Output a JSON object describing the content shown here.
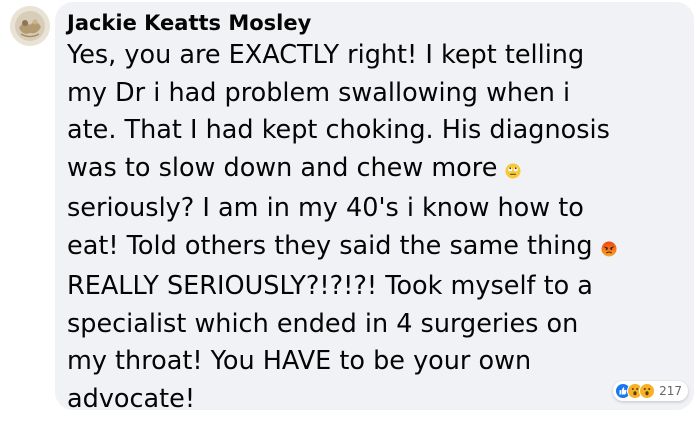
{
  "comment": {
    "author": "Jackie Keatts Mosley",
    "lines": [
      "Yes, you are EXACTLY right! I kept telling",
      "my Dr i had problem swallowing when i",
      "ate. That I had kept choking. His diagnosis",
      "was to slow down and chew more",
      "seriously? I am in my 40's i know how to",
      "eat! Told others they said the same thing",
      "REALLY SERIOUSLY?!?!?! Took myself to a",
      "specialist which ended in 4 surgeries on",
      "my throat! You HAVE to be your own",
      "advocate!"
    ],
    "inline_emojis": [
      "eye-roll-emoji",
      "angry-emoji"
    ]
  },
  "reactions": {
    "icons": [
      "like-icon",
      "wow-icon",
      "wow-icon"
    ],
    "count": "217"
  },
  "colors": {
    "bubble": "#f0f2f5",
    "text": "#050505",
    "meta": "#65676b",
    "like": "#1877f2",
    "wow": "#f7b125",
    "angry": "#e9710f"
  }
}
